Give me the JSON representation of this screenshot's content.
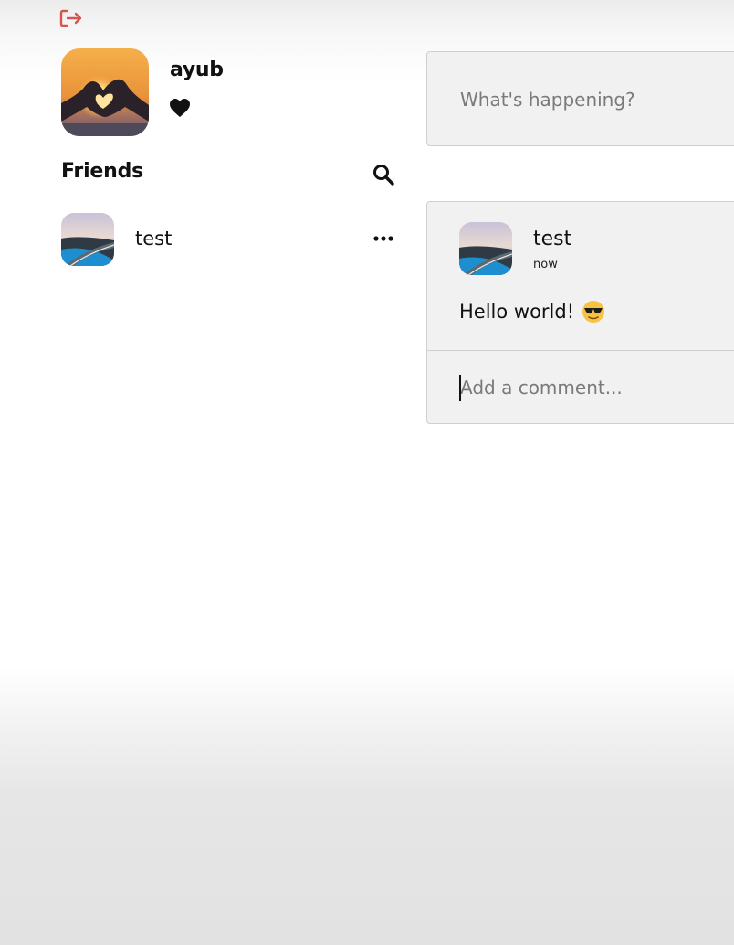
{
  "header": {
    "logout_icon": "logout-icon",
    "logout_color": "#d9534f"
  },
  "profile": {
    "name": "ayub",
    "avatar_icon": "heart-hands-sunset-photo",
    "like_icon": "heart-icon"
  },
  "friends": {
    "title": "Friends",
    "search_icon": "search-icon",
    "items": [
      {
        "name": "test",
        "avatar_icon": "road-landscape-photo",
        "menu_icon": "more-horizontal-icon"
      }
    ]
  },
  "composer": {
    "placeholder": "What's happening?"
  },
  "posts": [
    {
      "author": "test",
      "time": "now",
      "text": "Hello world!",
      "emoji": "sunglasses-face-emoji",
      "comment_placeholder": "Add a comment..."
    }
  ],
  "colors": {
    "card_background": "#f1f1f1",
    "card_border": "#cfcfcf",
    "text": "#111111",
    "placeholder": "#7a7a7a"
  }
}
